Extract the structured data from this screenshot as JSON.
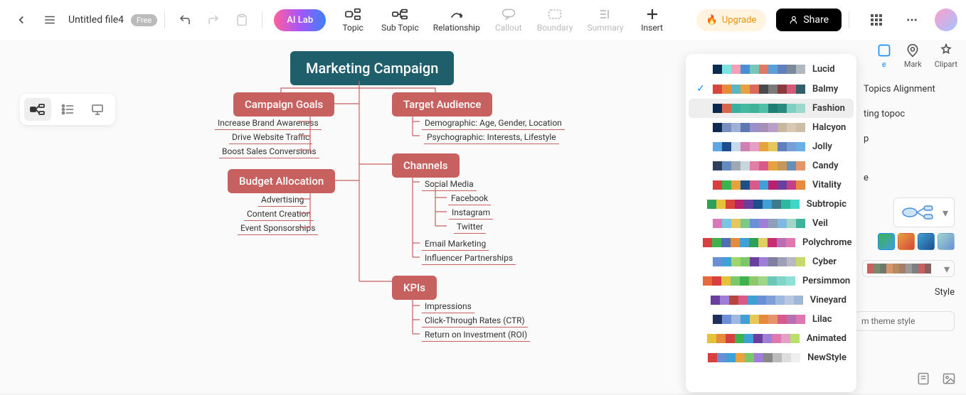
{
  "header": {
    "file_title": "Untitled file4",
    "free_badge": "Free",
    "ai_lab": "AI Lab",
    "upgrade": "Upgrade",
    "share": "Share",
    "tools": [
      {
        "id": "topic",
        "label": "Topic",
        "disabled": false
      },
      {
        "id": "subtopic",
        "label": "Sub Topic",
        "disabled": false
      },
      {
        "id": "relationship",
        "label": "Relationship",
        "disabled": false
      },
      {
        "id": "callout",
        "label": "Callout",
        "disabled": true
      },
      {
        "id": "boundary",
        "label": "Boundary",
        "disabled": true
      },
      {
        "id": "summary",
        "label": "Summary",
        "disabled": true
      },
      {
        "id": "insert",
        "label": "Insert",
        "disabled": false
      }
    ]
  },
  "mindmap": {
    "root": "Marketing Campaign",
    "branches": [
      {
        "title": "Campaign Goals",
        "children": [
          "Increase Brand Awareness",
          "Drive Website Traffic",
          "Boost Sales Conversions"
        ]
      },
      {
        "title": "Target Audience",
        "children": [
          "Demographic: Age, Gender, Location",
          "Psychographic: Interests, Lifestyle"
        ]
      },
      {
        "title": "Budget Allocation",
        "children": [
          "Advertising",
          "Content Creation",
          "Event Sponsorships"
        ]
      },
      {
        "title": "Channels",
        "children": [
          "Social Media",
          "Facebook",
          "Instagram",
          "Twitter",
          "Email Marketing",
          "Influencer Partnerships"
        ]
      },
      {
        "title": "KPIs",
        "children": [
          "Impressions",
          "Click-Through Rates (CTR)",
          "Return on Investment (ROI)"
        ]
      }
    ]
  },
  "rail": {
    "mark": "Mark",
    "clipart": "Clipart"
  },
  "side": {
    "align": "Topics Alignment",
    "ting": "ting topoc",
    "p": "p",
    "style": "Style",
    "custom": "m theme style"
  },
  "themes": [
    {
      "name": "Lucid",
      "colors": [
        "#0b2b4f",
        "#7ee3e0",
        "#f49fb6",
        "#4a8fd6",
        "#77c7b8",
        "#e07866",
        "#5aa0d8",
        "#5f7fbd",
        "#7a8a9a",
        "#b0b7bd"
      ],
      "selected": false
    },
    {
      "name": "Balmy",
      "colors": [
        "#d8453d",
        "#e68a3b",
        "#5ab6c2",
        "#e6a23c",
        "#d86b5a",
        "#4a4a4a",
        "#7a7a7a",
        "#8a3b3b",
        "#d45a7a",
        "#2f5f6b"
      ],
      "selected": true
    },
    {
      "name": "Fashion",
      "colors": [
        "#0a2850",
        "#d7664e",
        "#3ab0a0",
        "#46b8a0",
        "#3fb39a",
        "#4fbfa7",
        "#1f7f72",
        "#2a8a7d",
        "#7fd0c2",
        "#9cd8cc"
      ],
      "selected": false,
      "hovered": true
    },
    {
      "name": "Halcyon",
      "colors": [
        "#0e2952",
        "#7a8ebf",
        "#9fb0d6",
        "#5f77b0",
        "#9a8fc9",
        "#a58fb8",
        "#b99fc7",
        "#c8b7a0",
        "#d8c7b3",
        "#cbbfa6"
      ],
      "selected": false
    },
    {
      "name": "Jolly",
      "colors": [
        "#5ea7e6",
        "#1e4f8c",
        "#c8d8ec",
        "#d07fb2",
        "#e69fc4",
        "#e6a23c",
        "#e6c85a",
        "#5f7fbd",
        "#7a9fd6",
        "#6ab0e6"
      ],
      "selected": false
    },
    {
      "name": "Candy",
      "colors": [
        "#2e3f5c",
        "#658abf",
        "#9fa8b5",
        "#cad6de",
        "#df7fa6",
        "#d85a8a",
        "#e6a23c",
        "#c5995b",
        "#688fb8",
        "#e6956b"
      ],
      "selected": false
    },
    {
      "name": "Vitality",
      "colors": [
        "#d8403f",
        "#3eb24f",
        "#e6a23c",
        "#1e4f8c",
        "#d85a8a",
        "#3fa0d6",
        "#b82070",
        "#6a3fa0",
        "#c43f8a",
        "#e68a3b"
      ],
      "selected": false
    },
    {
      "name": "Subtropic",
      "colors": [
        "#2fa05a",
        "#e6c23c",
        "#d8453d",
        "#b82070",
        "#6a3fa0",
        "#1e4f8c",
        "#3fa0d6",
        "#3f7a8c",
        "#2fb8a0",
        "#3fd6c8"
      ],
      "selected": false
    },
    {
      "name": "Veil",
      "colors": [
        "#d878b8",
        "#7ac5e0",
        "#e6c85a",
        "#7ac88a",
        "#6a8fd6",
        "#9f7fd6",
        "#8f9fb8",
        "#7fb8e0",
        "#9fd6c8",
        "#3fb39a"
      ],
      "selected": false
    },
    {
      "name": "Polychrome",
      "colors": [
        "#d8403f",
        "#3eb24f",
        "#4e6fb3",
        "#e68a3b",
        "#3fa0d6",
        "#2fa05a",
        "#e0d060",
        "#c82f70",
        "#b86fb3",
        "#e078b0"
      ],
      "selected": false
    },
    {
      "name": "Cyber",
      "colors": [
        "#6a8fd6",
        "#3fa0d6",
        "#9fd66a",
        "#7ac86a",
        "#6a3fa0",
        "#9f7fd6",
        "#7f7fa0",
        "#9f9fb8",
        "#b8b8c8",
        "#c8d86a"
      ],
      "selected": false
    },
    {
      "name": "Persimmon",
      "colors": [
        "#e66a3c",
        "#d8403f",
        "#e6c23c",
        "#7ac86a",
        "#3eb24f",
        "#8fc86a",
        "#9fd68a",
        "#6ac8b8",
        "#7fd6c8",
        "#8fe0d6"
      ],
      "selected": false
    },
    {
      "name": "Vineyard",
      "colors": [
        "#6a3fa0",
        "#9f7fd6",
        "#b8453f",
        "#d85a8a",
        "#3fa0d6",
        "#6a8fd6",
        "#7f9fd6",
        "#9fb8e0",
        "#b8c8e0",
        "#9fb8d6"
      ],
      "selected": false
    },
    {
      "name": "Lilac",
      "colors": [
        "#1e2f5c",
        "#6a8fd6",
        "#9fb8e0",
        "#3fa0d6",
        "#e6c85a",
        "#e68a3b",
        "#e6956b",
        "#d85a8a",
        "#b86fb3",
        "#e078b0"
      ],
      "selected": false
    },
    {
      "name": "Animated",
      "colors": [
        "#e6c23c",
        "#e68a3b",
        "#d8403f",
        "#3eb24f",
        "#3fa0d6",
        "#6a3fa0",
        "#9f7fd6",
        "#e078b0",
        "#e69fc4",
        "#b8e06a"
      ],
      "selected": false
    },
    {
      "name": "NewStyle",
      "colors": [
        "#d8403f",
        "#6a8fd6",
        "#3fa0d6",
        "#e6a23c",
        "#7ac86a",
        "#9f7fd6",
        "#888888",
        "#bbbbbb",
        "#dddddd",
        "#efefef"
      ],
      "selected": false
    }
  ],
  "color_scheme_selected": [
    "#c7615f",
    "#7a8a6f",
    "#6b7a6b",
    "#d8956b",
    "#b88a5f",
    "#a67f6b",
    "#9a9a9a",
    "#7f7f7f",
    "#c7615f",
    "#8a5f5f"
  ]
}
